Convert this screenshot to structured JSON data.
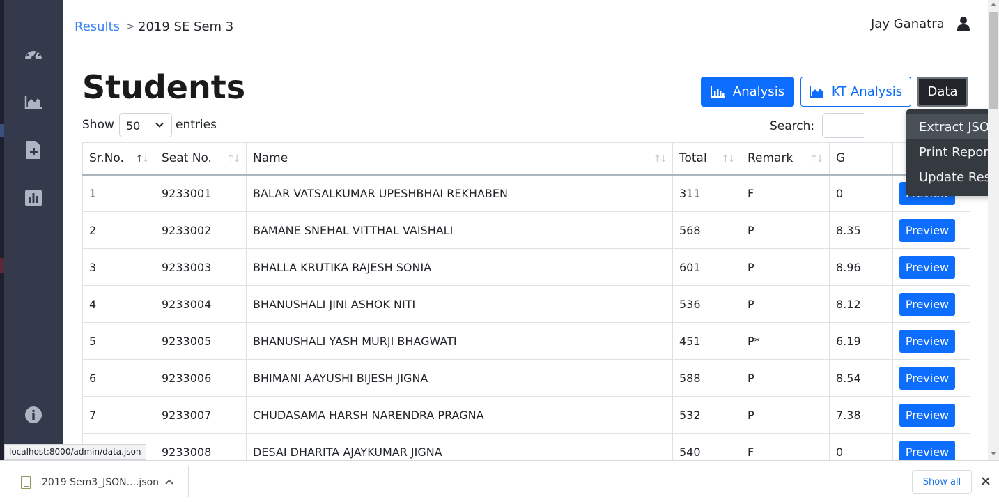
{
  "breadcrumb": {
    "parent": "Results",
    "separator": ">",
    "current": "2019 SE Sem 3"
  },
  "user": {
    "name": "Jay Ganatra"
  },
  "page": {
    "title": "Students"
  },
  "toolbar": {
    "analysis_label": "Analysis",
    "kt_analysis_label": "KT Analysis",
    "data_label": "Data"
  },
  "data_menu": {
    "items": [
      "Extract JSON",
      "Print Reports",
      "Update Result"
    ],
    "highlighted": "Extract JSON"
  },
  "length_control": {
    "show_label": "Show",
    "value": "50",
    "entries_label": "entries"
  },
  "search": {
    "label": "Search:"
  },
  "table": {
    "columns": [
      "Sr.No.",
      "Seat No.",
      "Name",
      "Total",
      "Remark",
      "G"
    ],
    "action_label": "Preview",
    "rows": [
      {
        "sr": "1",
        "seat": "9233001",
        "name": "BALAR VATSALKUMAR UPESHBHAI REKHABEN",
        "total": "311",
        "remark": "F",
        "gpa": "0"
      },
      {
        "sr": "2",
        "seat": "9233002",
        "name": "BAMANE SNEHAL VITTHAL VAISHALI",
        "total": "568",
        "remark": "P",
        "gpa": "8.35"
      },
      {
        "sr": "3",
        "seat": "9233003",
        "name": "BHALLA KRUTIKA RAJESH SONIA",
        "total": "601",
        "remark": "P",
        "gpa": "8.96"
      },
      {
        "sr": "4",
        "seat": "9233004",
        "name": "BHANUSHALI JINI ASHOK NITI",
        "total": "536",
        "remark": "P",
        "gpa": "8.12"
      },
      {
        "sr": "5",
        "seat": "9233005",
        "name": "BHANUSHALI YASH MURJI BHAGWATI",
        "total": "451",
        "remark": "P*",
        "gpa": "6.19"
      },
      {
        "sr": "6",
        "seat": "9233006",
        "name": "BHIMANI AAYUSHI BIJESH JIGNA",
        "total": "588",
        "remark": "P",
        "gpa": "8.54"
      },
      {
        "sr": "7",
        "seat": "9233007",
        "name": "CHUDASAMA HARSH NARENDRA PRAGNA",
        "total": "532",
        "remark": "P",
        "gpa": "7.38"
      },
      {
        "sr": "",
        "seat": "9233008",
        "name": "DESAI DHARITA AJAYKUMAR JIGNA",
        "total": "540",
        "remark": "F",
        "gpa": "0"
      }
    ]
  },
  "sidebar": {
    "icons": [
      "dashboard-icon",
      "area-chart-icon",
      "file-add-icon",
      "bar-chart-icon",
      "info-icon"
    ]
  },
  "status_bar": {
    "url": "localhost:8000/admin/data.json"
  },
  "download_bar": {
    "file_name": "2019 Sem3_JSON....json",
    "show_all_label": "Show all"
  },
  "colors": {
    "primary": "#0d6efd",
    "sidebar": "#343a4b",
    "dark_button": "#212529",
    "menu_bg": "#343a40",
    "link": "#3b82f6"
  }
}
